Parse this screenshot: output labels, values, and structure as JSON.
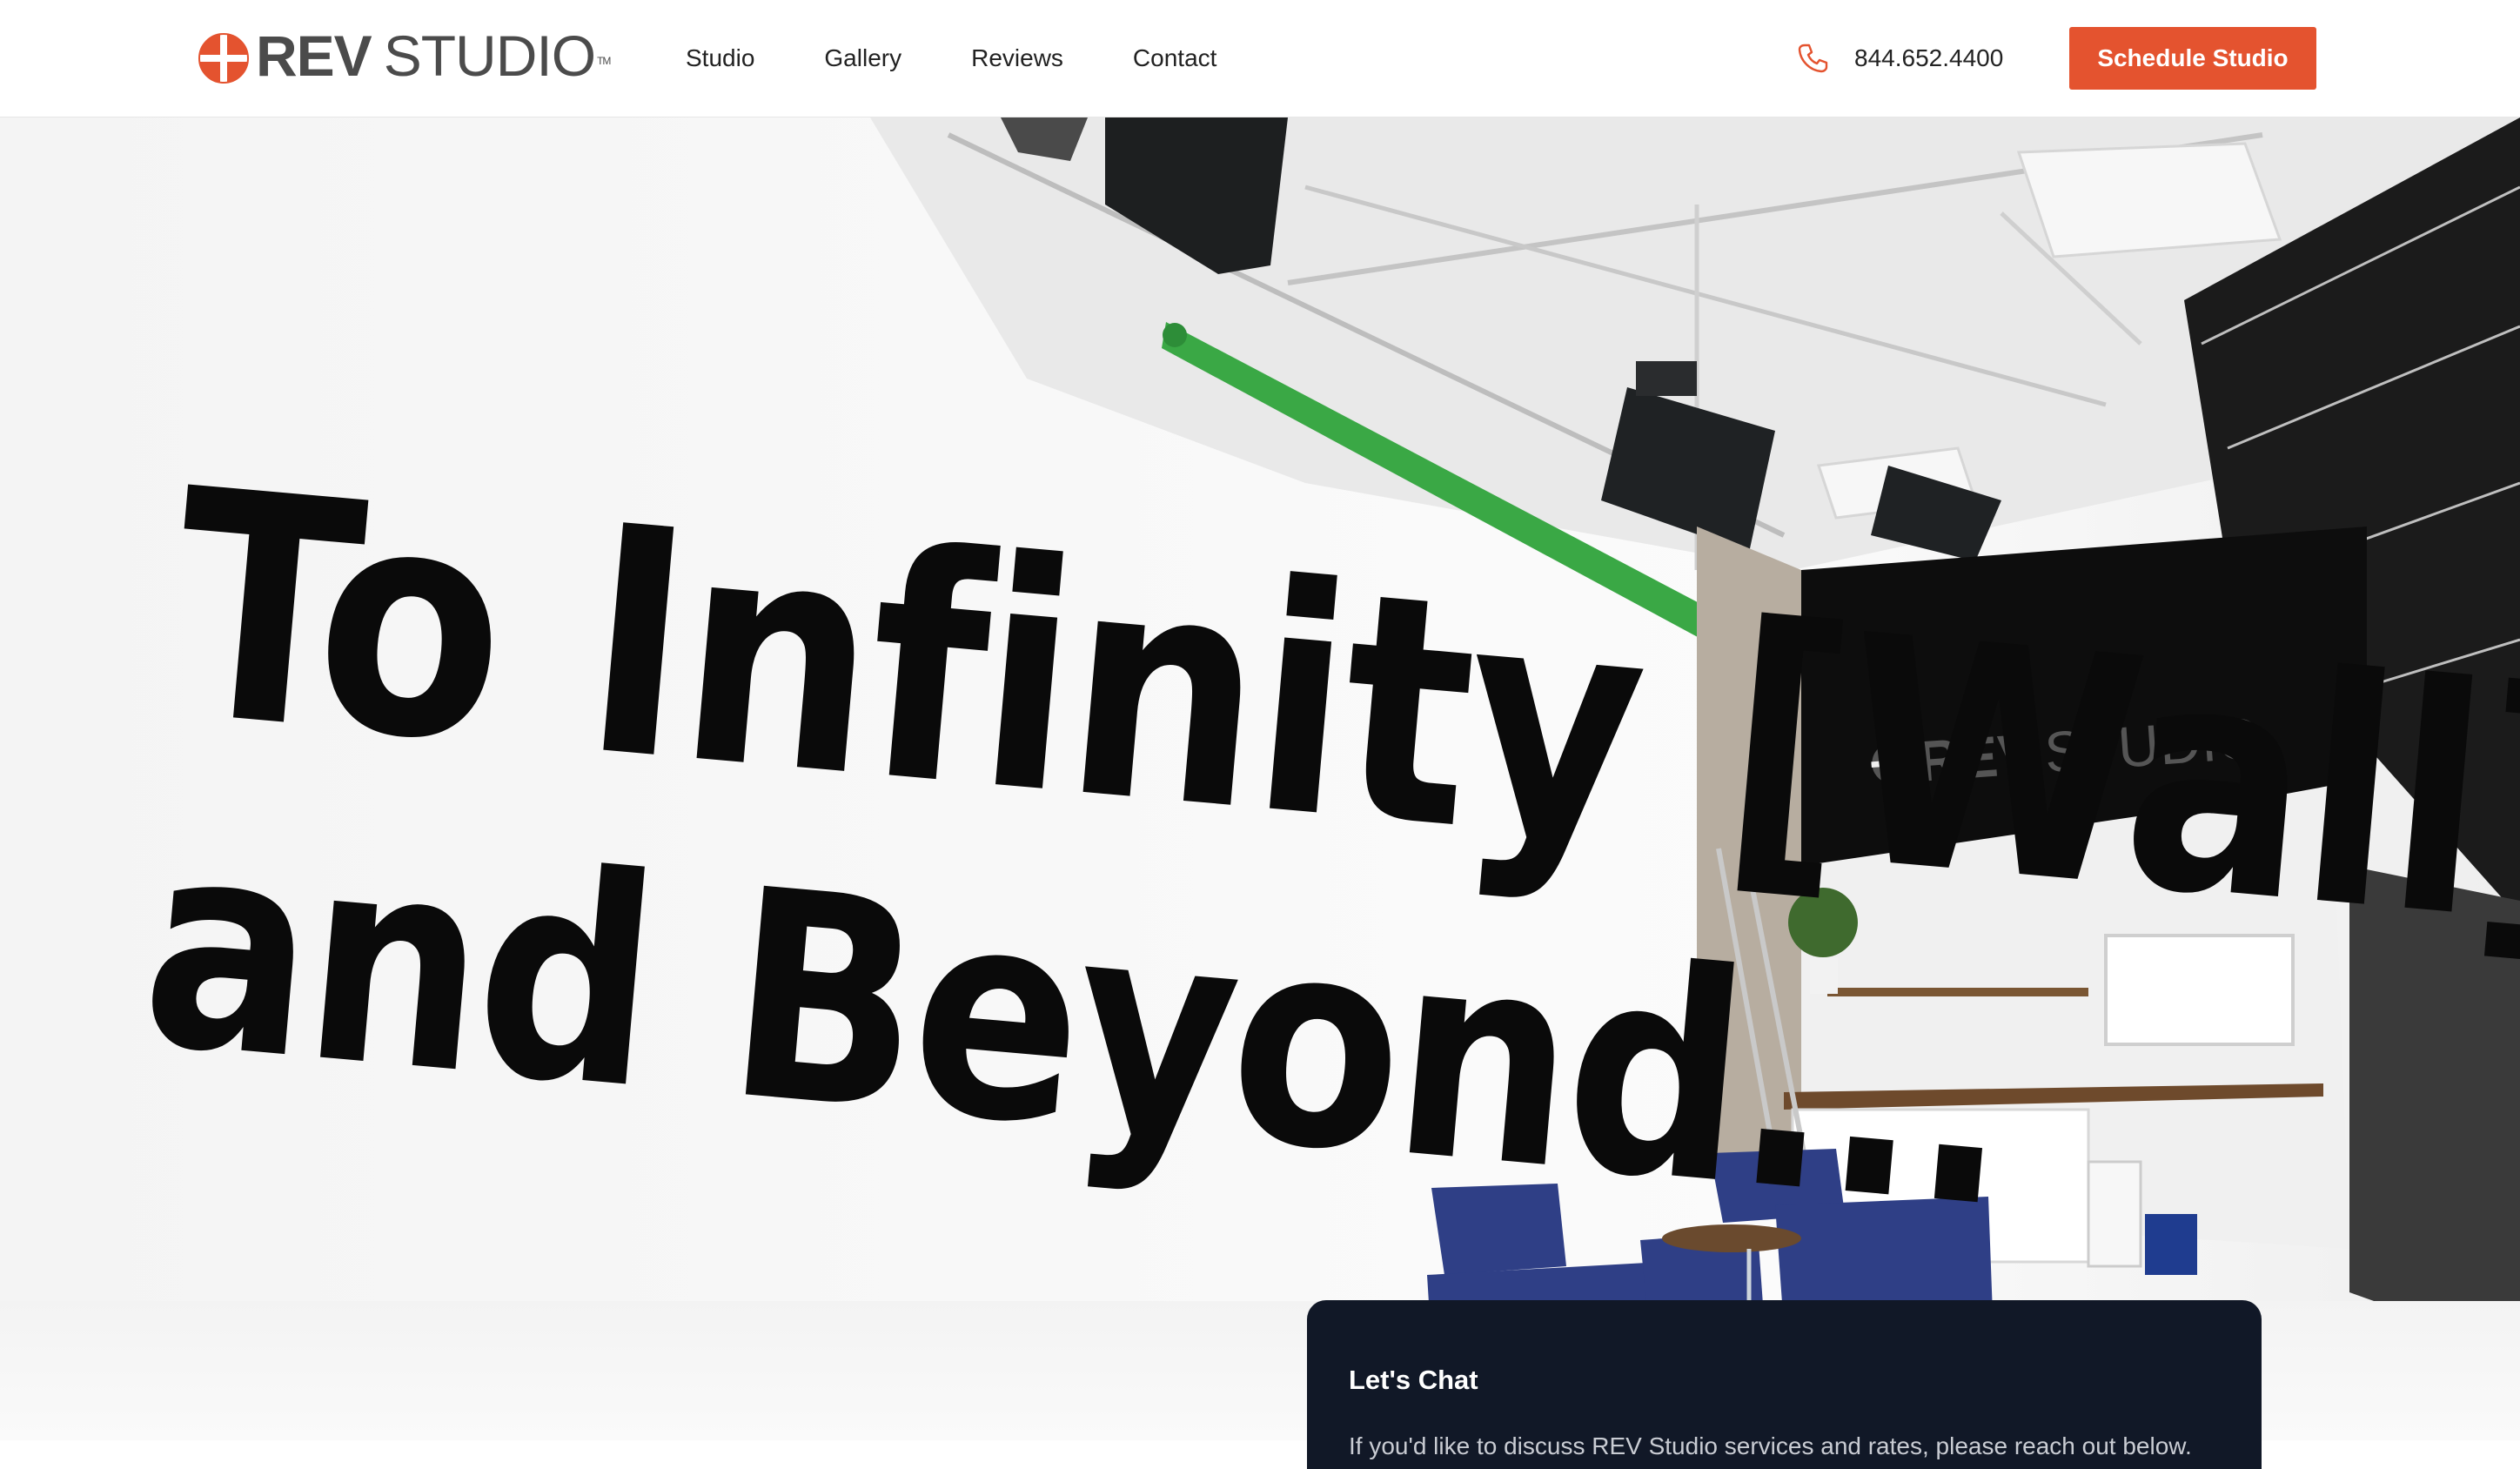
{
  "header": {
    "logo": {
      "brand_bold": "REV",
      "brand_light": "STUDIO",
      "tm": "TM"
    },
    "nav": [
      {
        "label": "Studio"
      },
      {
        "label": "Gallery"
      },
      {
        "label": "Reviews"
      },
      {
        "label": "Contact"
      }
    ],
    "phone": {
      "icon": "phone-icon",
      "number": "844.652.4400"
    },
    "cta_label": "Schedule Studio"
  },
  "hero": {
    "headline_line1": "To Infinity [Wall]",
    "headline_line2": "and Beyond...",
    "wall_sign": {
      "brand_bold": "REV",
      "brand_light": "STUDIO"
    }
  },
  "chat": {
    "title": "Let's Chat",
    "body": "If you'd like to discuss REV Studio services and rates, please reach out below."
  },
  "colors": {
    "accent": "#e4532f",
    "chat_bg": "#111827",
    "logo_gray": "#4b4b4b",
    "chair_blue": "#2f3f86",
    "green_screen": "#3aa845"
  }
}
